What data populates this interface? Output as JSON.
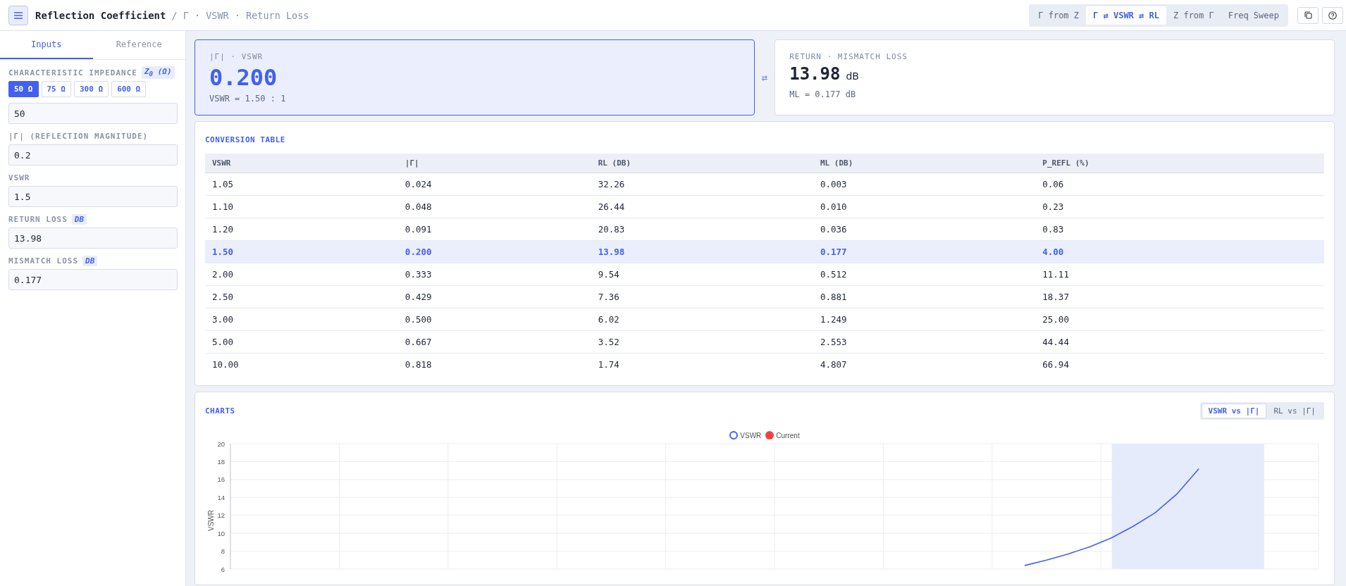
{
  "topbar": {
    "title": "Reflection Coefficient",
    "subtitle": "/ Γ · VSWR · Return Loss",
    "modes": [
      {
        "label": "Γ from Z",
        "selected": false
      },
      {
        "label": "Γ ⇄ VSWR ⇄ RL",
        "selected": true
      },
      {
        "label": "Z from Γ",
        "selected": false
      },
      {
        "label": "Freq Sweep",
        "selected": false
      }
    ]
  },
  "sidebar": {
    "tabs": [
      {
        "label": "Inputs",
        "selected": true
      },
      {
        "label": "Reference",
        "selected": false
      }
    ],
    "impedance": {
      "label": "CHARACTERISTIC IMPEDANCE",
      "badge": "Z$_{0}$ (Ω)",
      "presets": [
        {
          "label": "50 Ω",
          "selected": true
        },
        {
          "label": "75 Ω",
          "selected": false
        },
        {
          "label": "300 Ω",
          "selected": false
        },
        {
          "label": "600 Ω",
          "selected": false
        }
      ],
      "value": "50"
    },
    "fields": [
      {
        "label": "|Γ| (REFLECTION MAGNITUDE)",
        "value": "0.2"
      },
      {
        "label": "VSWR",
        "value": "1.5"
      },
      {
        "label": "RETURN LOSS",
        "badge": "DB",
        "value": "13.98"
      },
      {
        "label": "MISMATCH LOSS",
        "badge": "DB",
        "value": "0.177"
      }
    ]
  },
  "results": [
    {
      "title": "|Γ| · VSWR",
      "value": "0.200",
      "detail": "VSWR = 1.50 : 1",
      "selected": true
    },
    {
      "title": "RETURN · MISMATCH LOSS",
      "value": "13.98",
      "unit": "dB",
      "detail": "ML = 0.177 dB",
      "selected": false
    }
  ],
  "swap_symbol": "⇄",
  "table": {
    "title": "CONVERSION TABLE",
    "columns": [
      "VSWR",
      "|Γ|",
      "RL (DB)",
      "ML (DB)",
      "P_REFL (%)"
    ],
    "rows": [
      {
        "cells": [
          "1.05",
          "0.024",
          "32.26",
          "0.003",
          "0.06"
        ],
        "selected": false
      },
      {
        "cells": [
          "1.10",
          "0.048",
          "26.44",
          "0.010",
          "0.23"
        ],
        "selected": false
      },
      {
        "cells": [
          "1.20",
          "0.091",
          "20.83",
          "0.036",
          "0.83"
        ],
        "selected": false
      },
      {
        "cells": [
          "1.50",
          "0.200",
          "13.98",
          "0.177",
          "4.00"
        ],
        "selected": true
      },
      {
        "cells": [
          "2.00",
          "0.333",
          "9.54",
          "0.512",
          "11.11"
        ],
        "selected": false
      },
      {
        "cells": [
          "2.50",
          "0.429",
          "7.36",
          "0.881",
          "18.37"
        ],
        "selected": false
      },
      {
        "cells": [
          "3.00",
          "0.500",
          "6.02",
          "1.249",
          "25.00"
        ],
        "selected": false
      },
      {
        "cells": [
          "5.00",
          "0.667",
          "3.52",
          "2.553",
          "44.44"
        ],
        "selected": false
      },
      {
        "cells": [
          "10.00",
          "0.818",
          "1.74",
          "4.807",
          "66.94"
        ],
        "selected": false
      }
    ]
  },
  "charts": {
    "title": "CHARTS",
    "toggles": [
      {
        "label": "VSWR vs |Γ|",
        "selected": true
      },
      {
        "label": "RL vs |Γ|",
        "selected": false
      }
    ],
    "chart_data": {
      "type": "line",
      "ylabel": "VSWR",
      "categories": [
        null,
        null,
        null,
        null,
        null,
        null,
        null,
        null,
        null,
        null,
        null,
        null,
        null,
        null,
        null,
        null,
        null,
        null,
        null,
        null,
        null,
        null,
        null,
        null,
        null,
        null,
        null,
        null,
        null,
        null,
        null,
        null,
        null,
        null,
        null,
        null,
        null,
        null,
        null,
        null,
        null,
        null,
        null,
        null,
        null,
        null,
        null,
        null,
        null,
        null
      ],
      "grid": true,
      "ylim": [
        6,
        20
      ],
      "yticks": [
        6,
        8,
        10,
        12,
        14,
        16,
        18,
        20
      ],
      "series": [
        {
          "name": "VSWR",
          "color": "#4361ee",
          "values": [
            null,
            null,
            null,
            null,
            null,
            null,
            null,
            null,
            null,
            null,
            null,
            null,
            null,
            null,
            null,
            null,
            null,
            null,
            null,
            null,
            null,
            null,
            null,
            null,
            null,
            null,
            null,
            null,
            null,
            null,
            null,
            null,
            null,
            null,
            null,
            null,
            6.4,
            7.0,
            7.7,
            8.5,
            9.5,
            10.8,
            12.3,
            14.4,
            17.2,
            null,
            null,
            null,
            null,
            null
          ]
        },
        {
          "name": "Current",
          "color": "#ef4444",
          "values": [
            null,
            null,
            null,
            null,
            null,
            null,
            null,
            null,
            null,
            null,
            null,
            null,
            null,
            null,
            null,
            null,
            null,
            null,
            null,
            null,
            null,
            null,
            null,
            null,
            null,
            null,
            null,
            null,
            null,
            null,
            null,
            null,
            null,
            null,
            null,
            null,
            null,
            null,
            null,
            null,
            null,
            null,
            null,
            null,
            null,
            null,
            null,
            null,
            null,
            null
          ]
        }
      ]
    },
    "shaded_region": true
  }
}
